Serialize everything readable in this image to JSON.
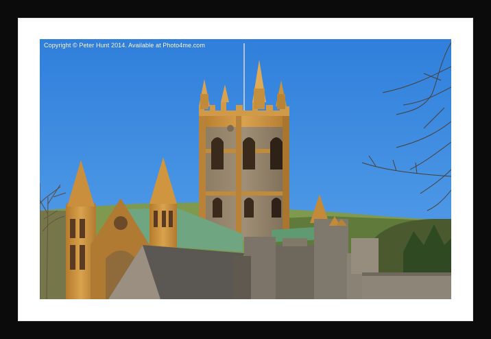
{
  "photo": {
    "copyright_text": "Copyright © Peter Hunt 2014. Available at Photo4me.com",
    "subject": "church-tower-with-spires"
  },
  "colors": {
    "frame": "#0b0b0b",
    "mount": "#ffffff",
    "sky": "#3c8be0",
    "stone_gold": "#c9923e",
    "slate_roof": "#5b5753",
    "copper_roof": "#6fa580"
  }
}
